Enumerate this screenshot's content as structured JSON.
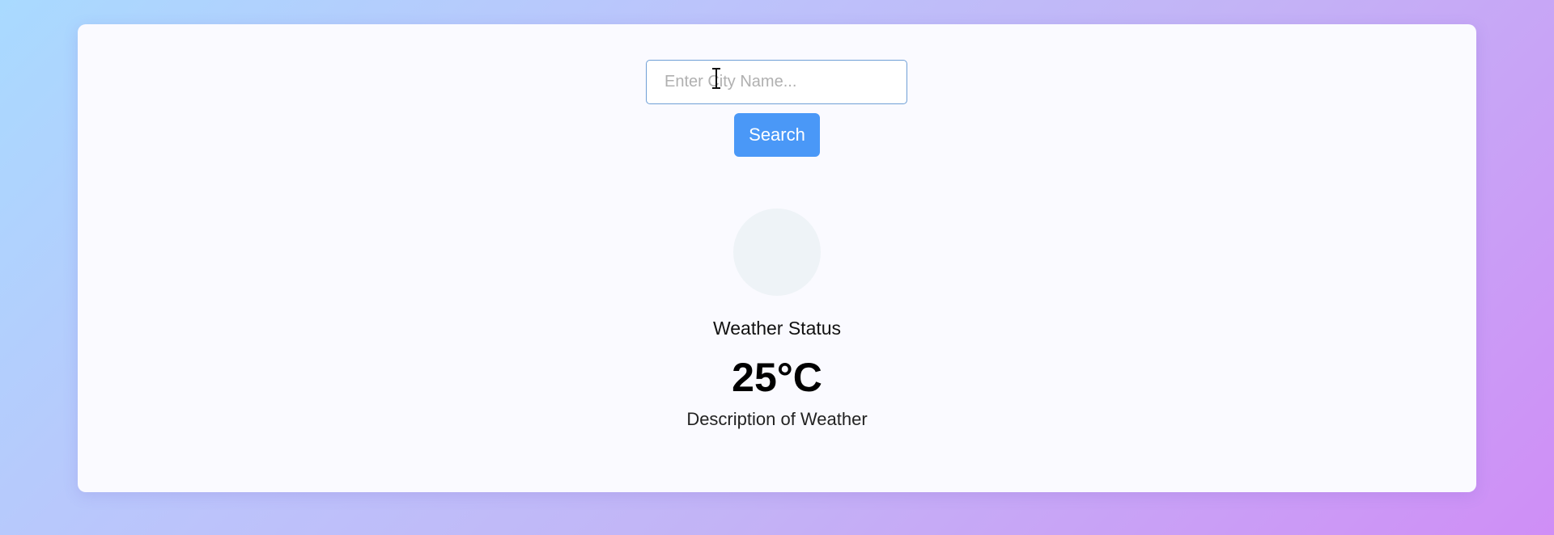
{
  "search": {
    "placeholder": "Enter City Name...",
    "value": "",
    "button_label": "Search"
  },
  "weather": {
    "icon": "weather-icon-placeholder",
    "status": "Weather Status",
    "temperature": "25°C",
    "description": "Description of Weather"
  },
  "colors": {
    "accent": "#4a98f7",
    "card_background": "#fafaff",
    "input_border": "#6f9fd6",
    "icon_placeholder": "#eef3f7"
  }
}
